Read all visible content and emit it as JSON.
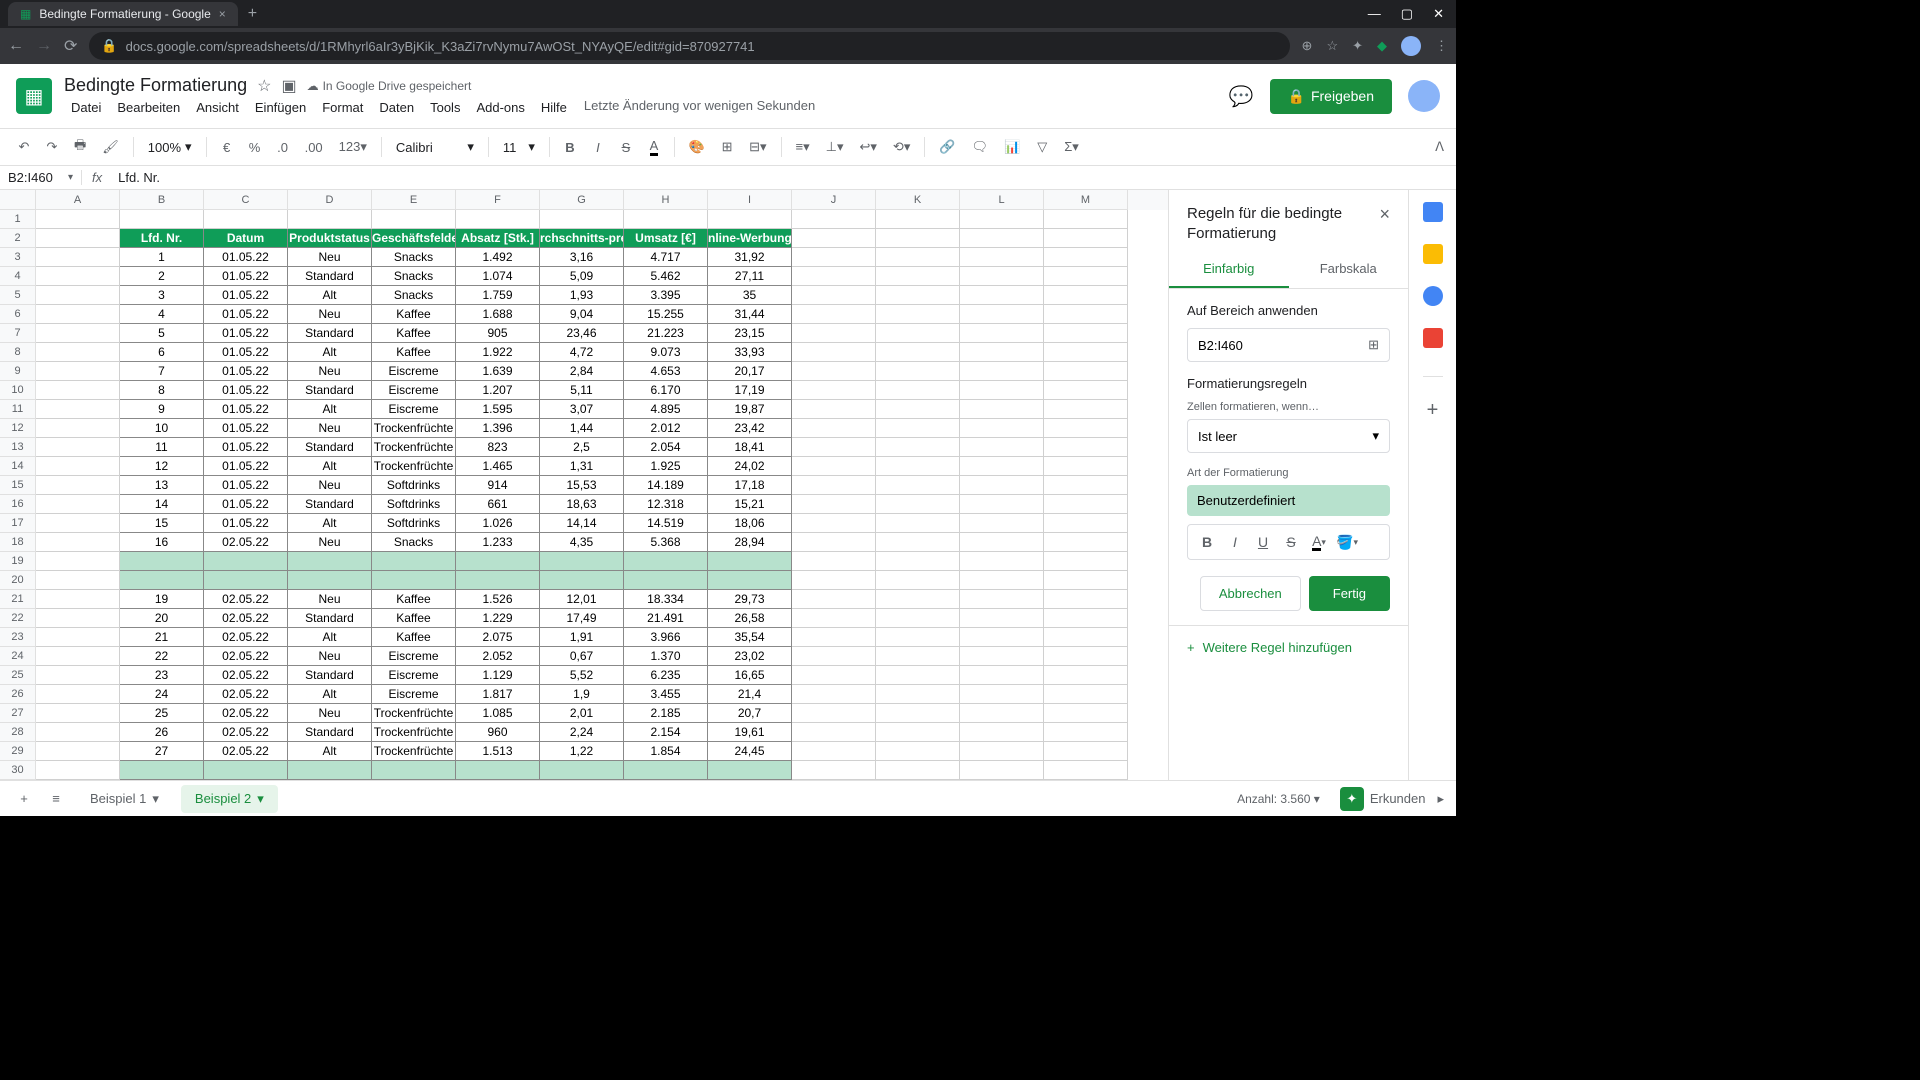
{
  "browser": {
    "tab_title": "Bedingte Formatierung - Google",
    "url": "docs.google.com/spreadsheets/d/1RMhyrl6aIr3yBjKik_K3aZi7rvNymu7AwOSt_NYAyQE/edit#gid=870927741"
  },
  "doc": {
    "title": "Bedingte Formatierung",
    "drive_status": "In Google Drive gespeichert",
    "last_edit": "Letzte Änderung vor wenigen Sekunden",
    "share_label": "Freigeben"
  },
  "menu": {
    "items": [
      "Datei",
      "Bearbeiten",
      "Ansicht",
      "Einfügen",
      "Format",
      "Daten",
      "Tools",
      "Add-ons",
      "Hilfe"
    ]
  },
  "toolbar": {
    "zoom": "100%",
    "font": "Calibri",
    "font_size": "11"
  },
  "formula_bar": {
    "name_box": "B2:I460",
    "value": "Lfd. Nr."
  },
  "columns": [
    "A",
    "B",
    "C",
    "D",
    "E",
    "F",
    "G",
    "H",
    "I",
    "J",
    "K",
    "L",
    "M"
  ],
  "headers": [
    "Lfd. Nr.",
    "Datum",
    "Produktstatus",
    "Geschäftsfelder",
    "Absatz [Stk.]",
    "rchschnitts-preis",
    "Umsatz [€]",
    "nline-Werbung ["
  ],
  "rows": [
    [
      "1",
      "01.05.22",
      "Neu",
      "Snacks",
      "1.492",
      "3,16",
      "4.717",
      "31,92"
    ],
    [
      "2",
      "01.05.22",
      "Standard",
      "Snacks",
      "1.074",
      "5,09",
      "5.462",
      "27,11"
    ],
    [
      "3",
      "01.05.22",
      "Alt",
      "Snacks",
      "1.759",
      "1,93",
      "3.395",
      "35"
    ],
    [
      "4",
      "01.05.22",
      "Neu",
      "Kaffee",
      "1.688",
      "9,04",
      "15.255",
      "31,44"
    ],
    [
      "5",
      "01.05.22",
      "Standard",
      "Kaffee",
      "905",
      "23,46",
      "21.223",
      "23,15"
    ],
    [
      "6",
      "01.05.22",
      "Alt",
      "Kaffee",
      "1.922",
      "4,72",
      "9.073",
      "33,93"
    ],
    [
      "7",
      "01.05.22",
      "Neu",
      "Eiscreme",
      "1.639",
      "2,84",
      "4.653",
      "20,17"
    ],
    [
      "8",
      "01.05.22",
      "Standard",
      "Eiscreme",
      "1.207",
      "5,11",
      "6.170",
      "17,19"
    ],
    [
      "9",
      "01.05.22",
      "Alt",
      "Eiscreme",
      "1.595",
      "3,07",
      "4.895",
      "19,87"
    ],
    [
      "10",
      "01.05.22",
      "Neu",
      "Trockenfrüchte",
      "1.396",
      "1,44",
      "2.012",
      "23,42"
    ],
    [
      "11",
      "01.05.22",
      "Standard",
      "Trockenfrüchte",
      "823",
      "2,5",
      "2.054",
      "18,41"
    ],
    [
      "12",
      "01.05.22",
      "Alt",
      "Trockenfrüchte",
      "1.465",
      "1,31",
      "1.925",
      "24,02"
    ],
    [
      "13",
      "01.05.22",
      "Neu",
      "Softdrinks",
      "914",
      "15,53",
      "14.189",
      "17,18"
    ],
    [
      "14",
      "01.05.22",
      "Standard",
      "Softdrinks",
      "661",
      "18,63",
      "12.318",
      "15,21"
    ],
    [
      "15",
      "01.05.22",
      "Alt",
      "Softdrinks",
      "1.026",
      "14,14",
      "14.519",
      "18,06"
    ],
    [
      "16",
      "02.05.22",
      "Neu",
      "Snacks",
      "1.233",
      "4,35",
      "5.368",
      "28,94"
    ],
    [
      "",
      "",
      "",
      "",
      "",
      "",
      "",
      ""
    ],
    [
      "",
      "",
      "",
      "",
      "",
      "",
      "",
      ""
    ],
    [
      "19",
      "02.05.22",
      "Neu",
      "Kaffee",
      "1.526",
      "12,01",
      "18.334",
      "29,73"
    ],
    [
      "20",
      "02.05.22",
      "Standard",
      "Kaffee",
      "1.229",
      "17,49",
      "21.491",
      "26,58"
    ],
    [
      "21",
      "02.05.22",
      "Alt",
      "Kaffee",
      "2.075",
      "1,91",
      "3.966",
      "35,54"
    ],
    [
      "22",
      "02.05.22",
      "Neu",
      "Eiscreme",
      "2.052",
      "0,67",
      "1.370",
      "23,02"
    ],
    [
      "23",
      "02.05.22",
      "Standard",
      "Eiscreme",
      "1.129",
      "5,52",
      "6.235",
      "16,65"
    ],
    [
      "24",
      "02.05.22",
      "Alt",
      "Eiscreme",
      "1.817",
      "1,9",
      "3.455",
      "21,4"
    ],
    [
      "25",
      "02.05.22",
      "Neu",
      "Trockenfrüchte",
      "1.085",
      "2,01",
      "2.185",
      "20,7"
    ],
    [
      "26",
      "02.05.22",
      "Standard",
      "Trockenfrüchte",
      "960",
      "2,24",
      "2.154",
      "19,61"
    ],
    [
      "27",
      "02.05.22",
      "Alt",
      "Trockenfrüchte",
      "1.513",
      "1,22",
      "1.854",
      "24,45"
    ],
    [
      "",
      "",
      "",
      "",
      "",
      "",
      "",
      ""
    ]
  ],
  "panel": {
    "title": "Regeln für die bedingte Formatierung",
    "tab_single": "Einfarbig",
    "tab_scale": "Farbskala",
    "apply_range_label": "Auf Bereich anwenden",
    "range_value": "B2:I460",
    "rules_label": "Formatierungsregeln",
    "format_when_label": "Zellen formatieren, wenn…",
    "condition": "Ist leer",
    "format_style_label": "Art der Formatierung",
    "format_preview": "Benutzerdefiniert",
    "cancel": "Abbrechen",
    "done": "Fertig",
    "add_rule": "Weitere Regel hinzufügen"
  },
  "sheets": {
    "tab1": "Beispiel 1",
    "tab2": "Beispiel 2"
  },
  "bottom": {
    "count": "Anzahl: 3.560",
    "explore": "Erkunden"
  }
}
